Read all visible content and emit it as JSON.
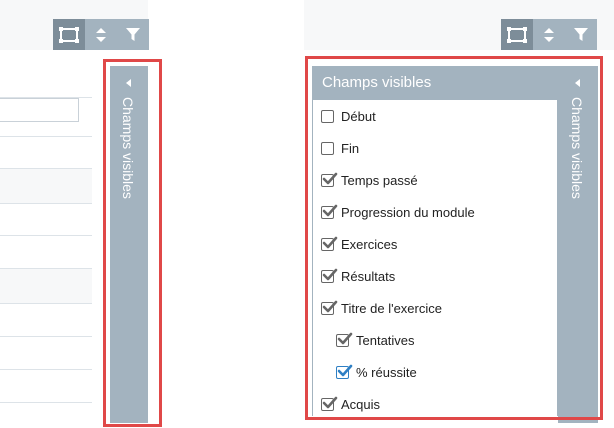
{
  "panel": {
    "title": "Champs visibles",
    "collapsed_label": "Champs visibles"
  },
  "toolbar": {
    "icons": [
      "columns-icon",
      "sort-icon",
      "filter-icon"
    ]
  },
  "fields": [
    {
      "label": "Début",
      "checked": false,
      "indent": false,
      "style": "gray"
    },
    {
      "label": "Fin",
      "checked": false,
      "indent": false,
      "style": "gray"
    },
    {
      "label": "Temps passé",
      "checked": true,
      "indent": false,
      "style": "gray"
    },
    {
      "label": "Progression du module",
      "checked": true,
      "indent": false,
      "style": "gray"
    },
    {
      "label": "Exercices",
      "checked": true,
      "indent": false,
      "style": "gray"
    },
    {
      "label": "Résultats",
      "checked": true,
      "indent": false,
      "style": "gray"
    },
    {
      "label": "Titre de l'exercice",
      "checked": true,
      "indent": false,
      "style": "gray"
    },
    {
      "label": "Tentatives",
      "checked": true,
      "indent": true,
      "style": "gray"
    },
    {
      "label": "% réussite",
      "checked": true,
      "indent": true,
      "style": "blue"
    },
    {
      "label": "Acquis",
      "checked": true,
      "indent": false,
      "style": "gray"
    }
  ],
  "colors": {
    "panel": "#a3b3bf",
    "toolbar_active": "#7d8d99",
    "highlight": "#e04848",
    "check_gray": "#666666",
    "check_blue": "#2e7fc4"
  }
}
